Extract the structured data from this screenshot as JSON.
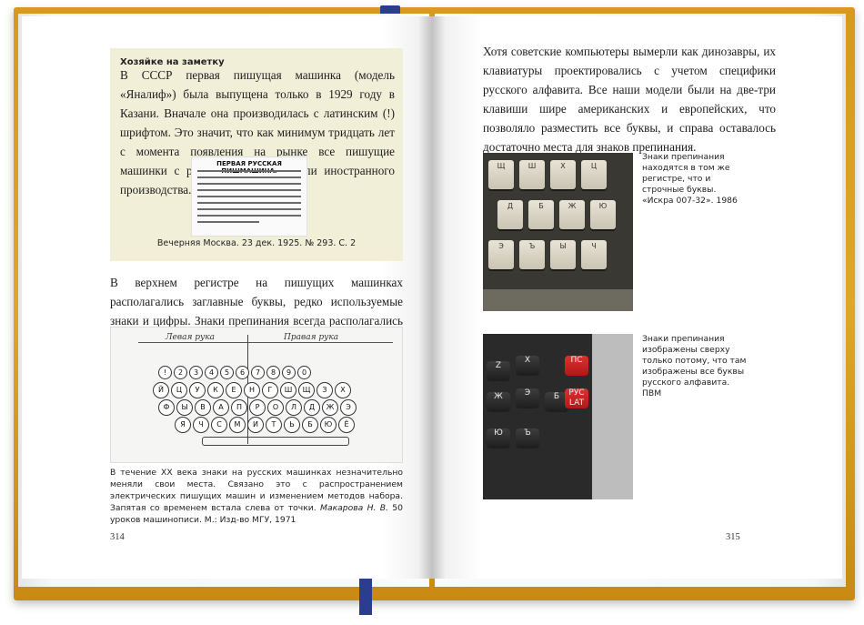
{
  "left_page": {
    "sidebar": {
      "heading": "Хозяйке на заметку",
      "text": "В СССР первая пишущая машинка (модель «Яналиф») была выпущена только в 1929 году в Казани. Вначале она производилась с латинским (!) шрифтом. Это значит, что как минимум тридцать лет с момента появления на рынке все пишущие машинки с русским шрифтом были иностранного производства.",
      "clipping_title": "ПЕРВАЯ РУССКАЯ ПИШМАШИНА.",
      "caption": "Вечерняя Москва. 23 дек. 1925. № 293. С. 2"
    },
    "body": "В верхнем регистре на пишущих машинках располагались заглавные буквы, редко используемые знаки и цифры. Знаки препинания всегда располагались в нижнем регистре.",
    "diagram": {
      "left_hand_label": "Левая рука",
      "right_hand_label": "Правая рука",
      "row_digits": [
        "!",
        "2",
        "3",
        "4",
        "5",
        "6",
        "7",
        "8",
        "9",
        "0"
      ],
      "row_top": [
        "Й",
        "Ц",
        "У",
        "К",
        "Е",
        "Н",
        "Г",
        "Ш",
        "Щ",
        "З",
        "Х"
      ],
      "row_mid": [
        "Ф",
        "Ы",
        "В",
        "А",
        "П",
        "Р",
        "О",
        "Л",
        "Д",
        "Ж",
        "Э"
      ],
      "row_bottom": [
        "Я",
        "Ч",
        "С",
        "М",
        "И",
        "Т",
        "Ь",
        "Б",
        "Ю",
        "Ё"
      ]
    },
    "caption_text": "В течение XX века знаки на русских машинках незначительно меняли свои места. Связано это с распространением электрических пишущих машин и изменением методов набора. Запятая со временем встала слева от точки. ",
    "caption_source_author": "Макарова Н. В.",
    "caption_source_rest": " 50 уроков машинописи. М.: Изд-во МГУ, 1971",
    "page_number": "314"
  },
  "right_page": {
    "body": "Хотя советские компьютеры вымерли как динозавры, их клавиатуры проектировались с учетом специфики русского алфавита. Все наши модели были на две-три клавиши шире американских и европейских, что позволяло разместить все буквы, и справа оставалось достаточно места для знаков препинания.",
    "photo1_caption": "Знаки препинания находятся в том же регистре, что и строчные буквы. «Искра 007-32». 1986",
    "photo2_caption": "Знаки препинания изображены сверху только потому, что там изображены все буквы русского алфавита. ПВМ",
    "photo1_keys": [
      "Щ",
      "Ш",
      "Х",
      "Ц",
      "Д",
      "Б",
      "Ж",
      "Ю",
      "Э",
      "Ъ",
      "Ы",
      "Ч"
    ],
    "photo2_keys": [
      "Z",
      "Х",
      "Ж",
      "Э",
      "Б",
      "Ю",
      "Ъ",
      "ПС",
      "РУС LAT"
    ],
    "page_number": "315"
  },
  "colors": {
    "cover": "#d9981e",
    "ribbon": "#2b3d8f",
    "sidebar_bg": "#f2efd9",
    "red_key": "#d02828"
  }
}
